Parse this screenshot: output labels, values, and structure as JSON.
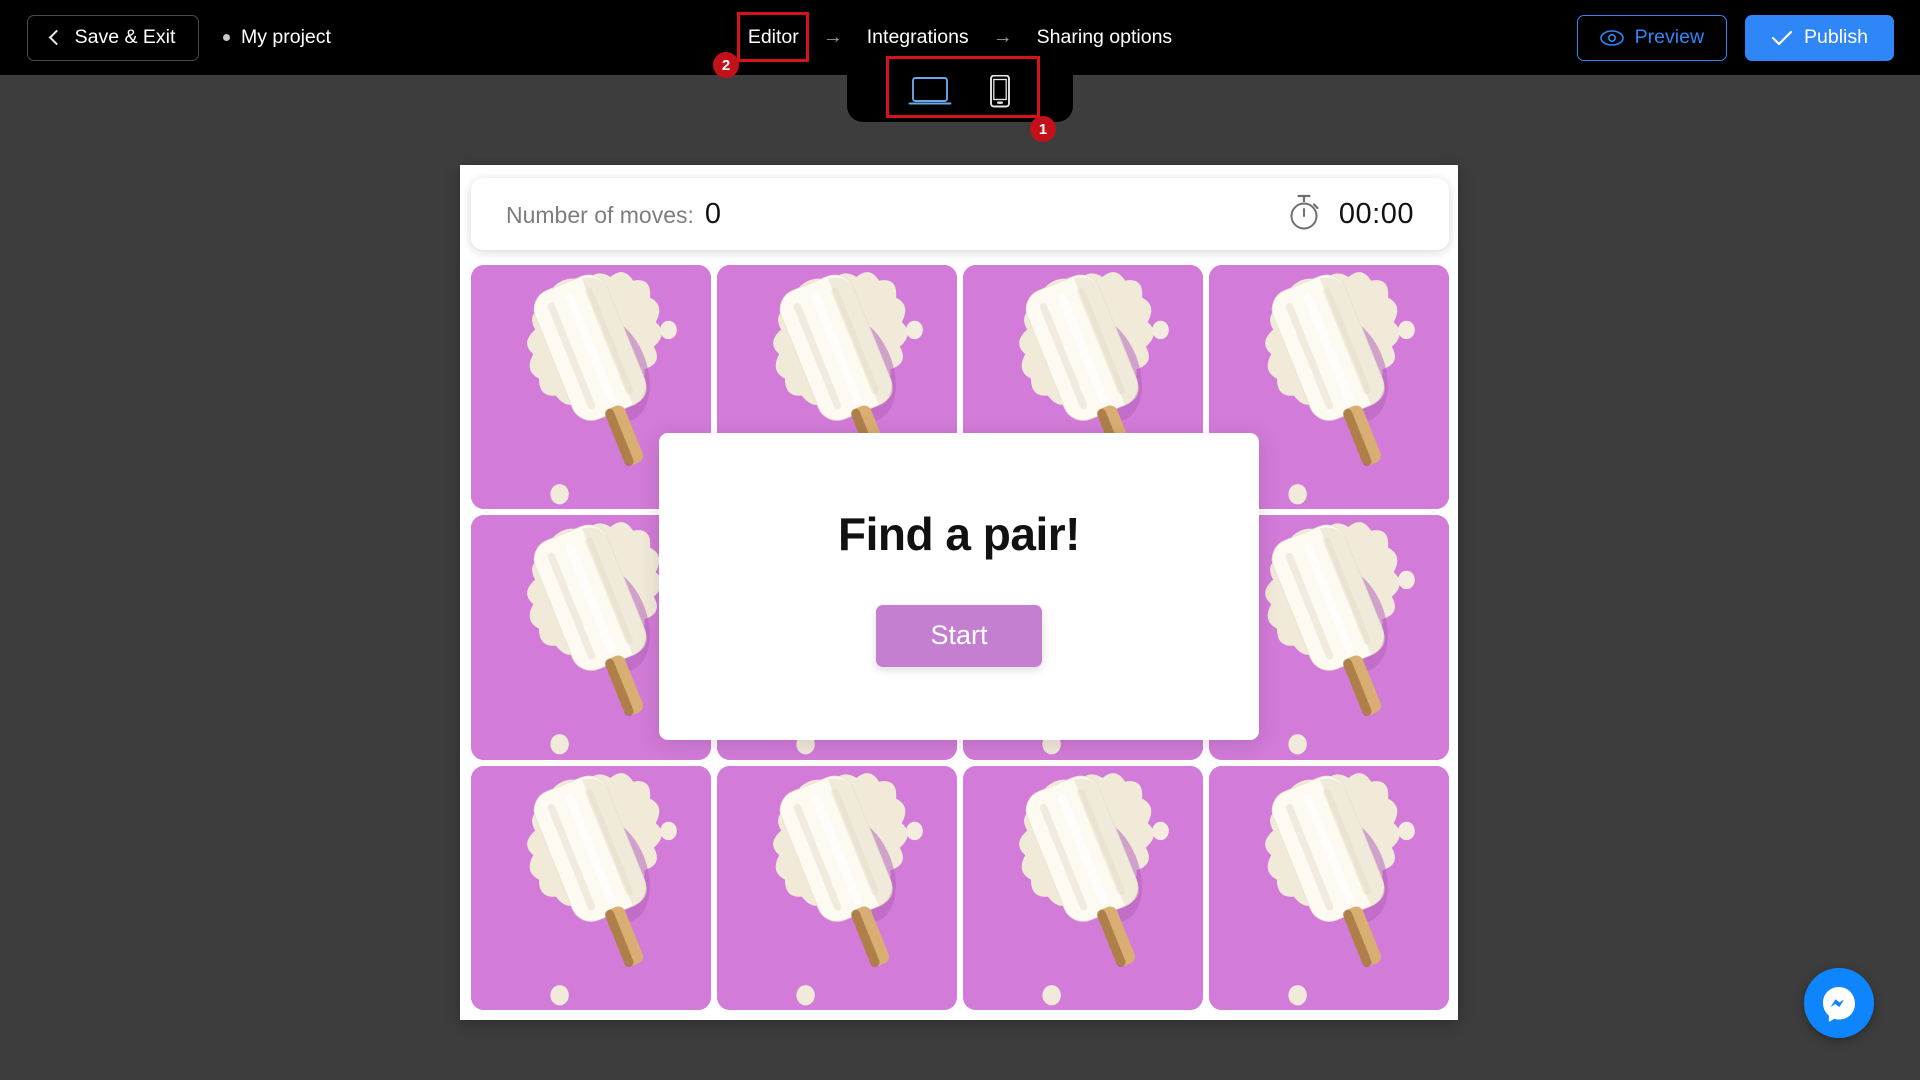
{
  "topbar": {
    "save_exit_label": "Save & Exit",
    "project_name": "My project",
    "breadcrumb": [
      {
        "label": "Editor",
        "active": true
      },
      {
        "label": "Integrations",
        "active": false
      },
      {
        "label": "Sharing options",
        "active": false
      }
    ],
    "breadcrumb_separator": "→",
    "preview_label": "Preview",
    "publish_label": "Publish"
  },
  "device_toggle": {
    "desktop_label": "desktop",
    "mobile_label": "mobile",
    "selected": "desktop"
  },
  "annotations": [
    {
      "id": "1",
      "target": "device-toggle"
    },
    {
      "id": "2",
      "target": "editor-tab"
    }
  ],
  "game": {
    "moves_label": "Number of moves:",
    "moves_value": "0",
    "timer_value": "00:00",
    "timer_icon": "stopwatch-icon",
    "modal": {
      "title": "Find a pair!",
      "start_label": "Start"
    },
    "card_count": 12,
    "card_image": "popsicle-ice-cream"
  },
  "chat": {
    "label": "messenger-chat-button"
  },
  "colors": {
    "accent_blue": "#2f86f6",
    "card_pink": "#d27bd8",
    "start_pink": "#c57fd0",
    "annotation_red": "#d8121a",
    "workspace_gray": "#3d3d3d",
    "topbar_black": "#000000",
    "messenger_blue": "#0f85fd"
  }
}
